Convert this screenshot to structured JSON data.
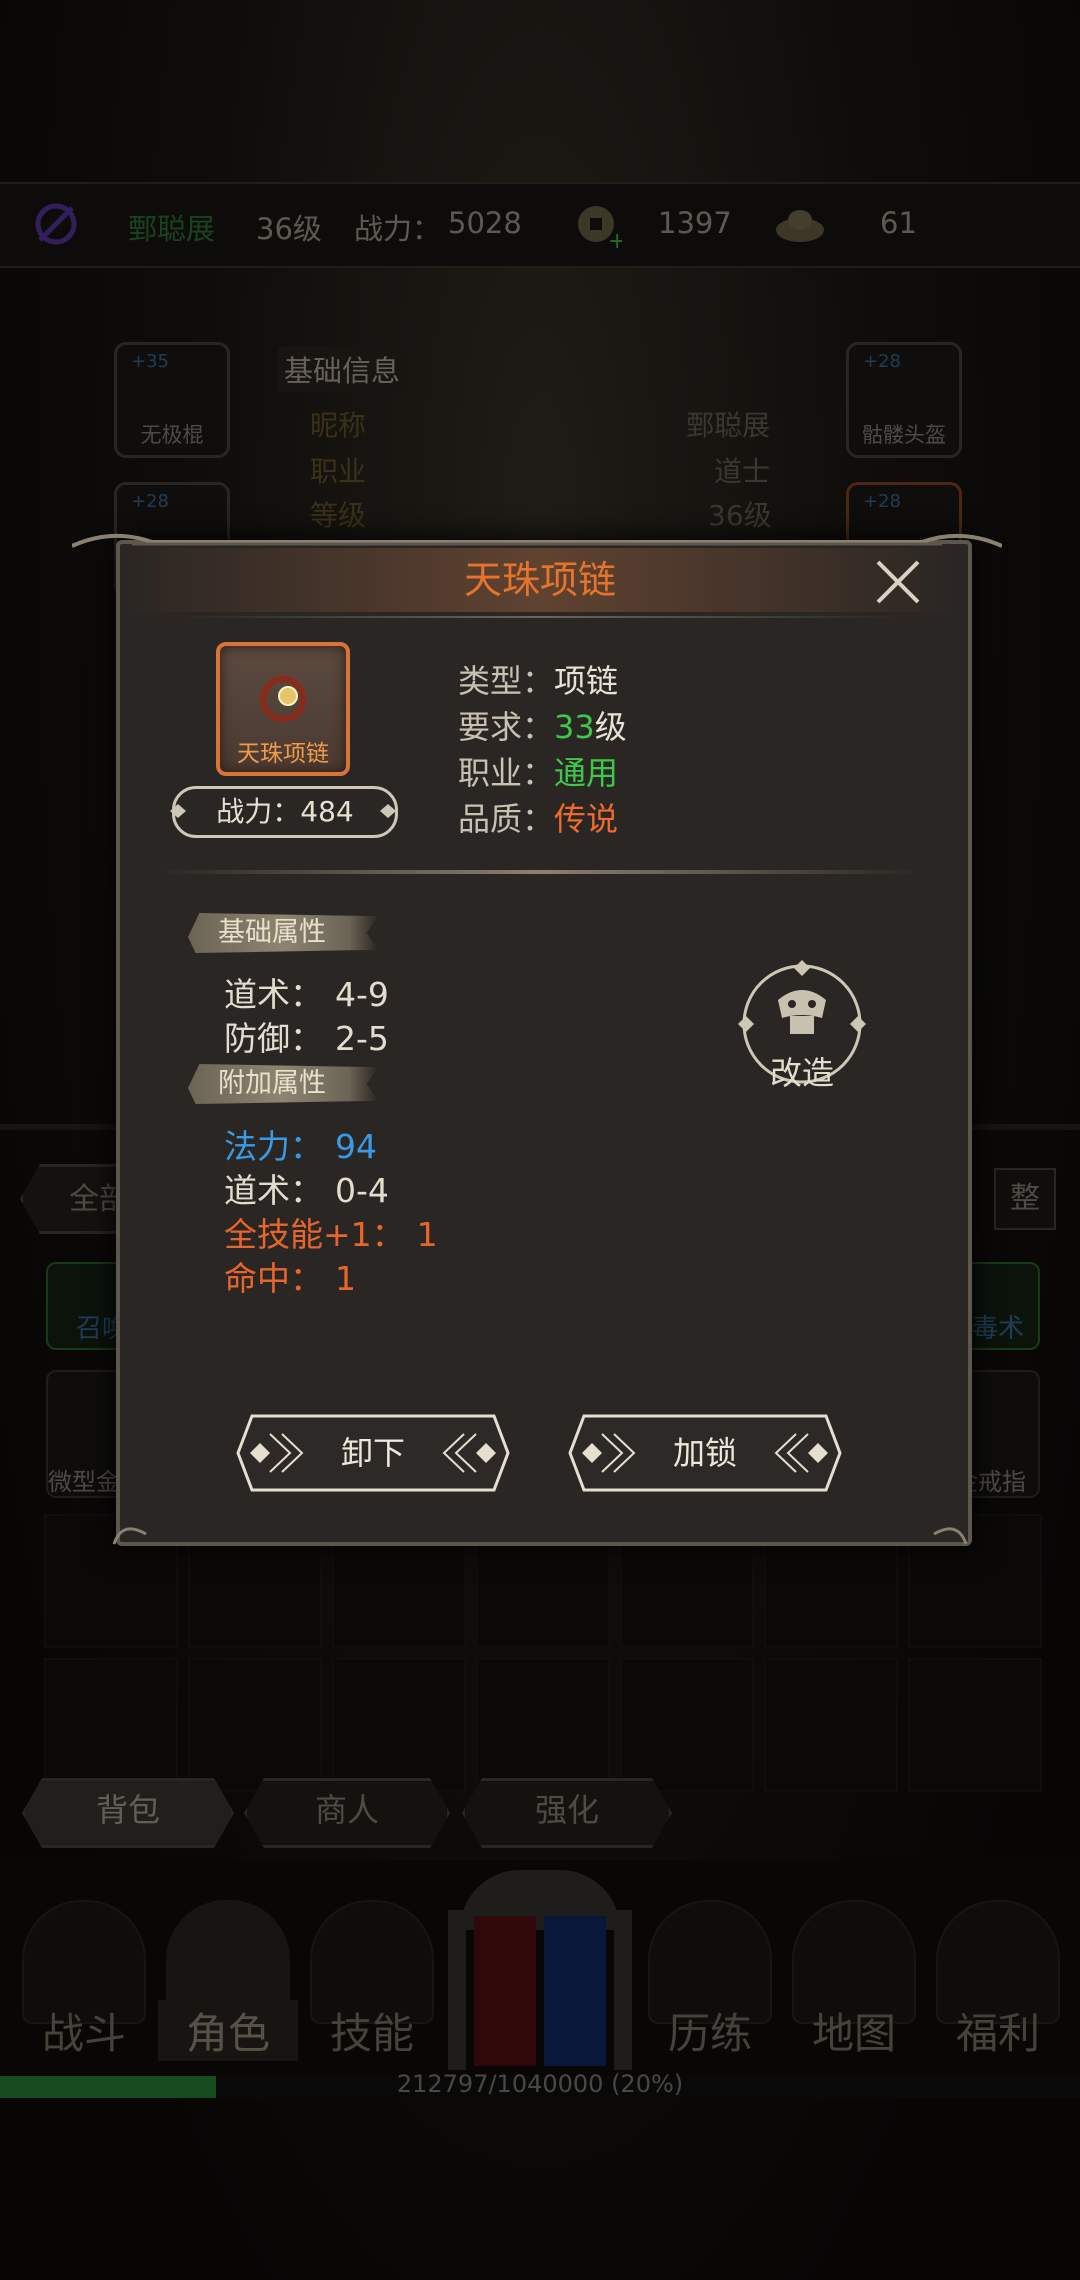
{
  "header": {
    "player_name": "鄄聪展",
    "level": "36级",
    "power_label": "战力：",
    "power_value": "5028",
    "copper": "1397",
    "gold": "61"
  },
  "equipment": {
    "left_slots": [
      {
        "level": "+35",
        "name": "无极棍"
      },
      {
        "level": "+28",
        "name": ""
      }
    ],
    "right_slots": [
      {
        "level": "+28",
        "name": "骷髅头盔"
      },
      {
        "level": "+28",
        "name": ""
      }
    ],
    "info_title": "基础信息",
    "info_rows": [
      {
        "label": "昵称",
        "value": "鄄聪展"
      },
      {
        "label": "职业",
        "value": "道士"
      },
      {
        "label": "等级",
        "value": "36级"
      }
    ]
  },
  "bag": {
    "filter_label": "全部",
    "sort_label": "整",
    "visible_items": [
      "召唤",
      "微型金",
      "毒术",
      "金戒指"
    ]
  },
  "tabs": [
    "背包",
    "商人",
    "强化"
  ],
  "nav": [
    "战斗",
    "角色",
    "技能",
    "历练",
    "地图",
    "福利"
  ],
  "xp": {
    "text": "212797/1040000 (20%)",
    "fraction": 0.2
  },
  "dialog": {
    "title": "天珠项链",
    "item_name": "天珠项链",
    "power_text": "战力：484",
    "props": [
      {
        "label": "类型：",
        "value": "项链",
        "value2": ""
      },
      {
        "label": "要求：",
        "value": "33",
        "value2": "级"
      },
      {
        "label": "职业：",
        "value": "通用",
        "value2": ""
      },
      {
        "label": "品质：",
        "value": "传说",
        "value2": ""
      }
    ],
    "base_section": "基础属性",
    "base_attrs": [
      {
        "label": "道术：",
        "value": "4-9"
      },
      {
        "label": "防御：",
        "value": "2-5"
      }
    ],
    "extra_section": "附加属性",
    "extra_attrs": [
      {
        "label": "法力：",
        "value": "94"
      },
      {
        "label": "道术：",
        "value": "0-4"
      },
      {
        "label": "全技能+1：",
        "value": "1"
      },
      {
        "label": "命中：",
        "value": "1"
      }
    ],
    "reforge_label": "改造",
    "unequip_label": "卸下",
    "lock_label": "加锁"
  },
  "colors": {
    "title": "#e8732a",
    "green": "#3ec84a",
    "legend": "#ef6a2c",
    "blue_attr": "#3a9ae6",
    "orange_attr": "#e8652c"
  }
}
